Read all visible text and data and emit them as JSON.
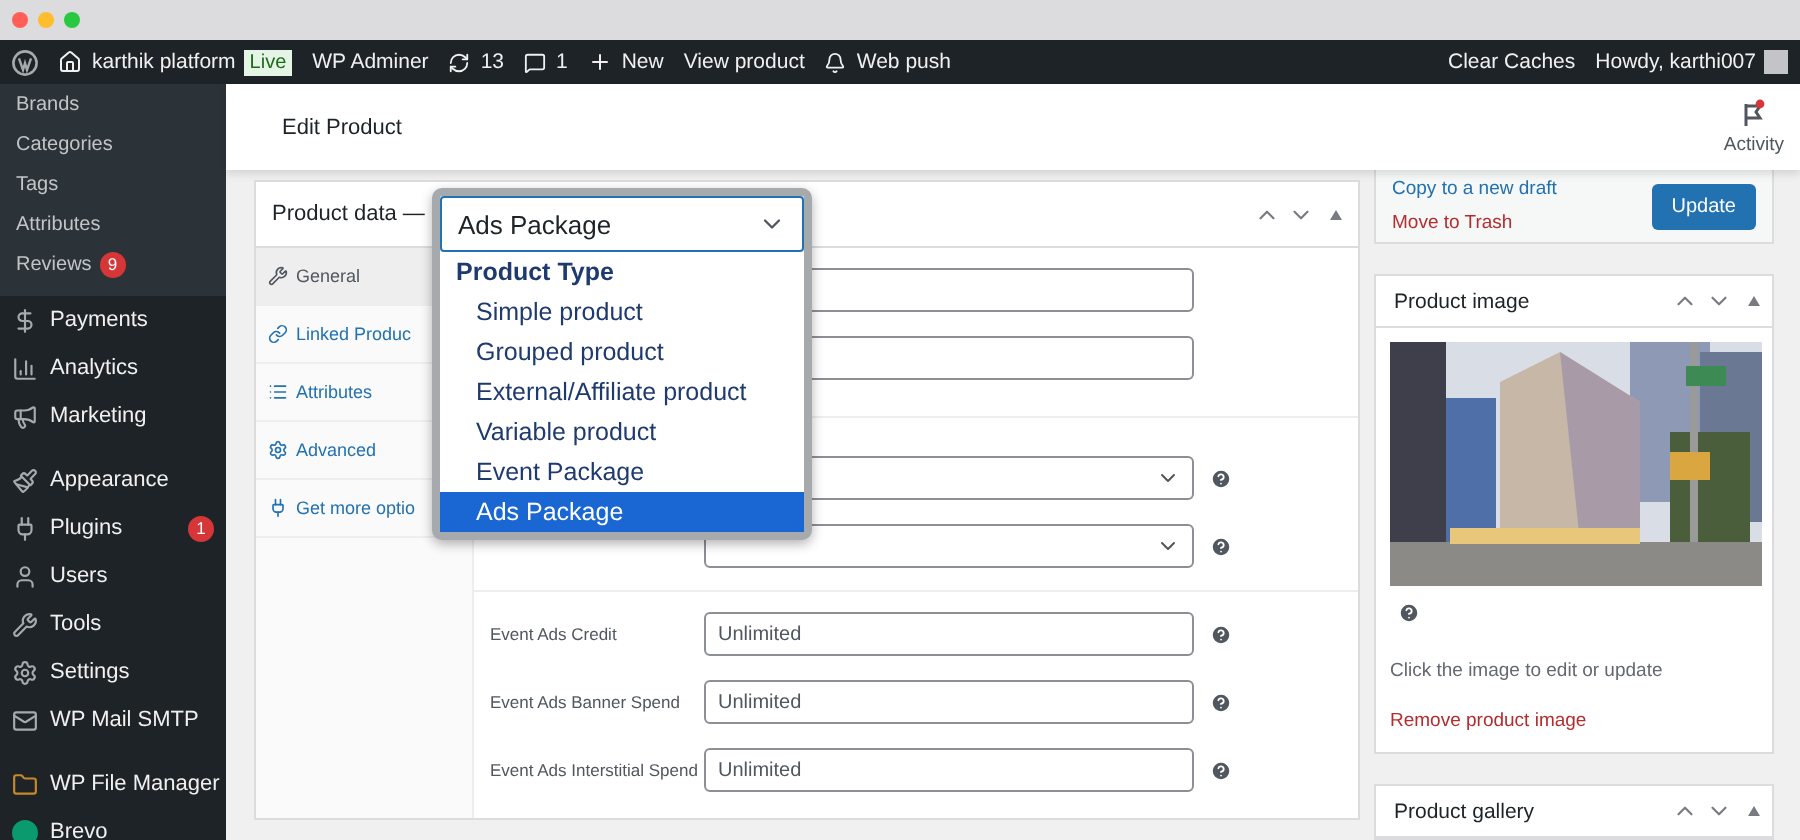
{
  "admin_bar": {
    "site": "karthik platform",
    "live_badge": "Live",
    "plugin": "WP Adminer",
    "updates": "13",
    "comments": "1",
    "new": "New",
    "view": "View product",
    "push": "Web push",
    "clear_caches": "Clear Caches",
    "howdy": "Howdy, karthi007"
  },
  "sidebar": {
    "submenu": [
      {
        "label": "Brands"
      },
      {
        "label": "Categories"
      },
      {
        "label": "Tags"
      },
      {
        "label": "Attributes"
      },
      {
        "label": "Reviews",
        "badge": "9"
      }
    ],
    "menu_groups": [
      {
        "items": [
          {
            "label": "Payments",
            "kind": "payments"
          },
          {
            "label": "Analytics",
            "kind": "analytics"
          },
          {
            "label": "Marketing",
            "kind": "marketing"
          }
        ]
      },
      {
        "items": [
          {
            "label": "Appearance",
            "kind": "appearance"
          },
          {
            "label": "Plugins",
            "kind": "plugins",
            "badge": "1"
          },
          {
            "label": "Users",
            "kind": "users"
          },
          {
            "label": "Tools",
            "kind": "tools"
          },
          {
            "label": "Settings",
            "kind": "settings"
          },
          {
            "label": "WP Mail SMTP",
            "kind": "mail"
          }
        ]
      },
      {
        "items": [
          {
            "label": "WP File Manager",
            "kind": "folder"
          },
          {
            "label": "Brevo",
            "kind": "brevo"
          }
        ]
      }
    ]
  },
  "header": {
    "title": "Edit Product",
    "activity": "Activity"
  },
  "product_data": {
    "title": "Product data —",
    "type_select": {
      "value": "Ads Package",
      "group": "Product Type",
      "options": [
        {
          "label": "Simple product",
          "selected": false
        },
        {
          "label": "Grouped product",
          "selected": false
        },
        {
          "label": "External/Affiliate product",
          "selected": false
        },
        {
          "label": "Variable product",
          "selected": false
        },
        {
          "label": "Event Package",
          "selected": false
        },
        {
          "label": "Ads Package",
          "selected": true
        }
      ]
    },
    "tabs": [
      {
        "label": "General",
        "kind": "wrench",
        "selected": true
      },
      {
        "label": "Linked Produc",
        "kind": "link",
        "selected": false
      },
      {
        "label": "Attributes",
        "kind": "list",
        "selected": false
      },
      {
        "label": "Advanced",
        "kind": "gear",
        "selected": false
      },
      {
        "label": "Get more optio",
        "kind": "plug",
        "selected": false
      }
    ],
    "fields": [
      {
        "kind": "input",
        "help": false
      },
      {
        "kind": "input",
        "help": false
      },
      {
        "kind": "divider"
      },
      {
        "kind": "select",
        "help": true
      },
      {
        "kind": "select",
        "help": true
      },
      {
        "kind": "divider"
      },
      {
        "kind": "input",
        "label": "Event Ads Credit",
        "value": "Unlimited",
        "help": true
      },
      {
        "kind": "input",
        "label": "Event Ads Banner Spend",
        "value": "Unlimited",
        "help": true
      },
      {
        "kind": "input",
        "label": "Event Ads Interstitial Spend",
        "value": "Unlimited",
        "help": true
      }
    ]
  },
  "publish": {
    "copy_link": "Copy to a new draft",
    "trash_link": "Move to Trash",
    "update_button": "Update"
  },
  "product_image": {
    "title": "Product image",
    "caption": "Click the image to edit or update",
    "remove_link": "Remove product image"
  },
  "product_gallery": {
    "title": "Product gallery"
  }
}
